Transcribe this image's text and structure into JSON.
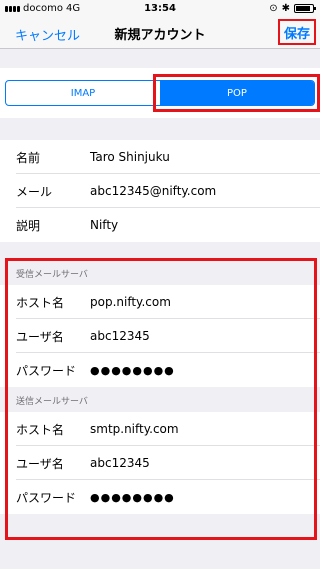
{
  "status_bar": {
    "carrier": "docomo",
    "network": "4G",
    "time": "13:54",
    "battery_level": 0.9
  },
  "nav": {
    "cancel_label": "キャンセル",
    "title": "新規アカウント",
    "save_label": "保存"
  },
  "account_type": {
    "options": [
      "IMAP",
      "POP"
    ],
    "selected": "POP"
  },
  "account": {
    "name_label": "名前",
    "name_value": "Taro Shinjuku",
    "email_label": "メール",
    "email_value": "abc12345@nifty.com",
    "description_label": "説明",
    "description_value": "Nifty"
  },
  "incoming": {
    "header": "受信メールサーバ",
    "host_label": "ホスト名",
    "host_value": "pop.nifty.com",
    "user_label": "ユーザ名",
    "user_value": "abc12345",
    "password_label": "パスワード",
    "password_value": "●●●●●●●●"
  },
  "outgoing": {
    "header": "送信メールサーバ",
    "host_label": "ホスト名",
    "host_value": "smtp.nifty.com",
    "user_label": "ユーザ名",
    "user_value": "abc12345",
    "password_label": "パスワード",
    "password_value": "●●●●●●●●"
  },
  "colors": {
    "accent": "#007aff",
    "highlight": "#e5131a",
    "background": "#efeff4"
  }
}
